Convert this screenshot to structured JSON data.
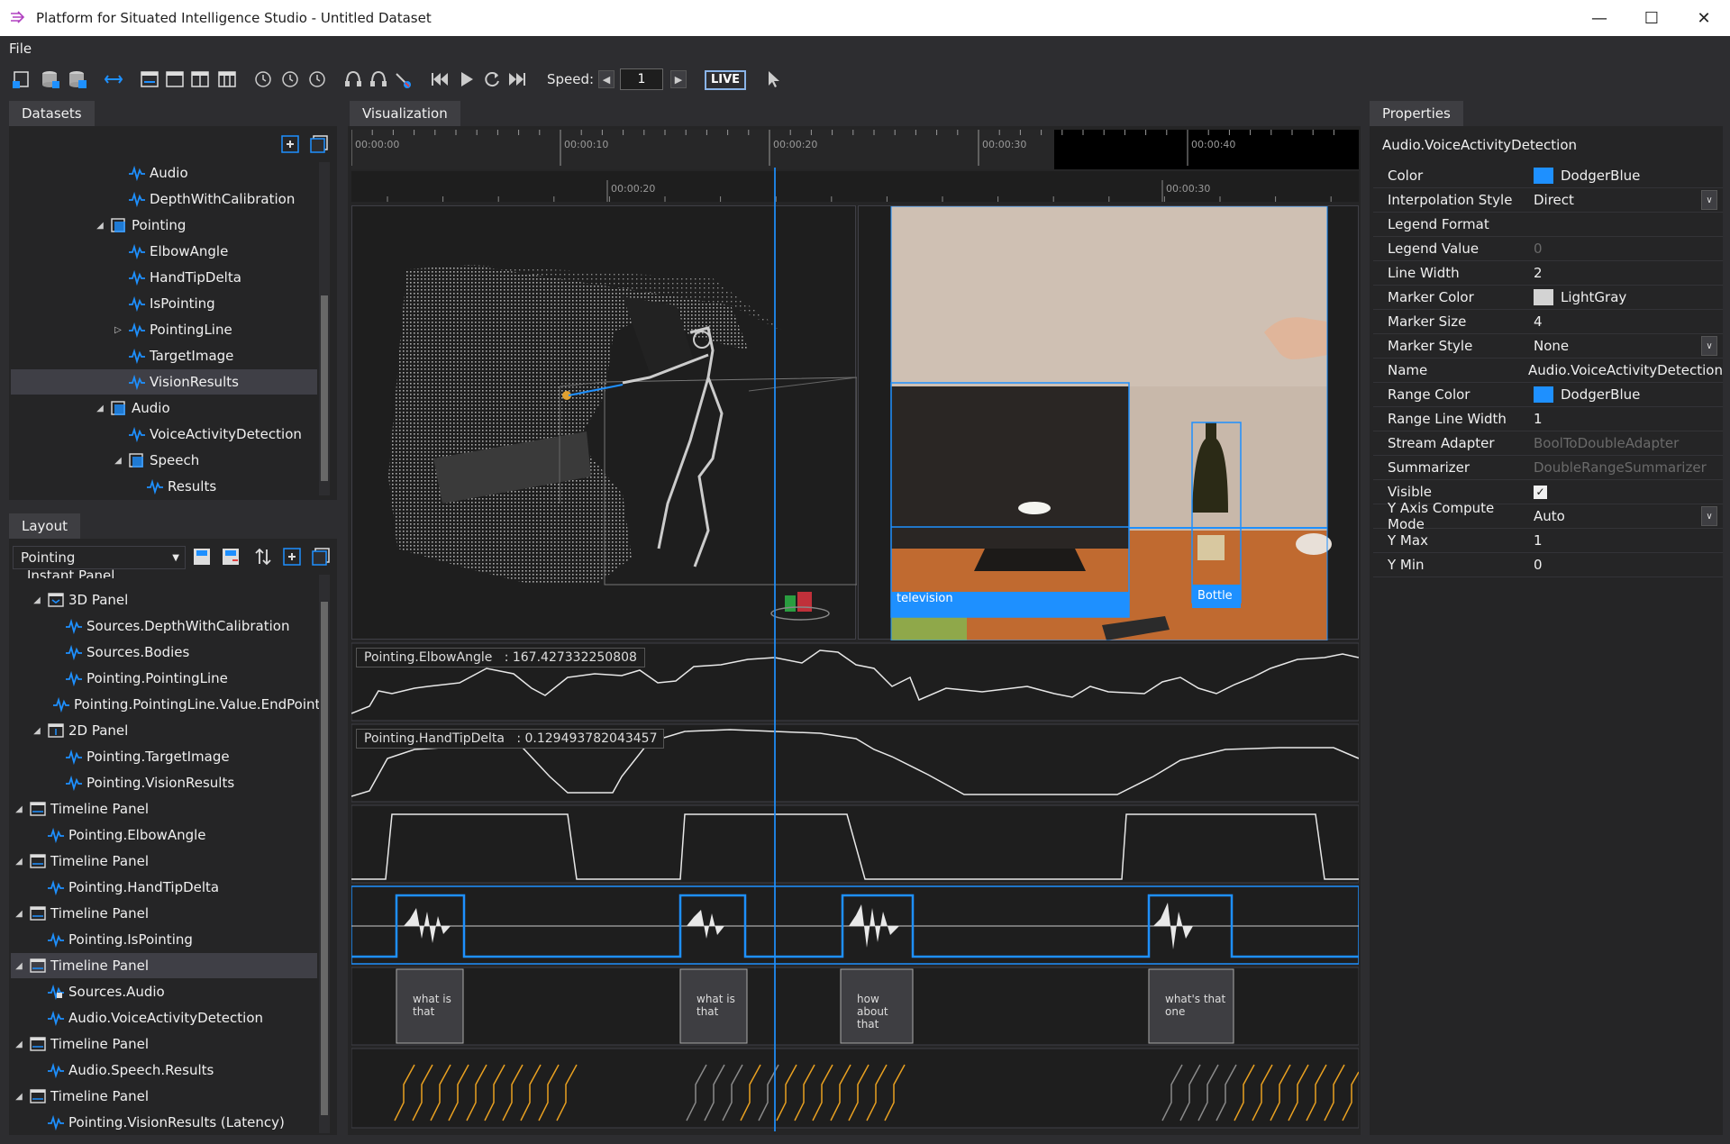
{
  "window": {
    "title": "Platform for Situated Intelligence Studio - Untitled Dataset",
    "accent": "#1e90ff"
  },
  "menu": {
    "file": "File"
  },
  "toolbar": {
    "speed_label": "Speed:",
    "speed_value": "1",
    "live_label": "LIVE"
  },
  "datasets": {
    "tab_label": "Datasets",
    "items": [
      {
        "label": "Audio",
        "level": 3,
        "icon": "stream-icon"
      },
      {
        "label": "DepthWithCalibration",
        "level": 3,
        "icon": "stream-icon"
      },
      {
        "label": "Pointing",
        "level": 2,
        "icon": "partition-icon",
        "expanded": true
      },
      {
        "label": "ElbowAngle",
        "level": 3,
        "icon": "stream-icon"
      },
      {
        "label": "HandTipDelta",
        "level": 3,
        "icon": "stream-icon"
      },
      {
        "label": "IsPointing",
        "level": 3,
        "icon": "stream-icon"
      },
      {
        "label": "PointingLine",
        "level": 3,
        "icon": "stream-icon",
        "collapsed": true
      },
      {
        "label": "TargetImage",
        "level": 3,
        "icon": "stream-icon"
      },
      {
        "label": "VisionResults",
        "level": 3,
        "icon": "stream-icon",
        "selected": true
      },
      {
        "label": "Audio",
        "level": 2,
        "icon": "partition-icon",
        "expanded": true
      },
      {
        "label": "VoiceActivityDetection",
        "level": 3,
        "icon": "stream-icon"
      },
      {
        "label": "Speech",
        "level": 3,
        "icon": "partition-icon",
        "expanded": true
      },
      {
        "label": "Results",
        "level": 4,
        "icon": "stream-icon"
      }
    ]
  },
  "layout": {
    "tab_label": "Layout",
    "selected_layout": "Pointing",
    "partial_top_item": "Instant Panel",
    "items": [
      {
        "label": "3D Panel",
        "level": 2,
        "icon": "panel3d-icon",
        "expanded": true
      },
      {
        "label": "Sources.DepthWithCalibration",
        "level": 3,
        "icon": "stream-icon"
      },
      {
        "label": "Sources.Bodies",
        "level": 3,
        "icon": "stream-icon"
      },
      {
        "label": "Pointing.PointingLine",
        "level": 3,
        "icon": "stream-icon"
      },
      {
        "label": "Pointing.PointingLine.Value.EndPoint",
        "level": 3,
        "icon": "stream-icon"
      },
      {
        "label": "2D Panel",
        "level": 2,
        "icon": "panel2d-icon",
        "expanded": true
      },
      {
        "label": "Pointing.TargetImage",
        "level": 3,
        "icon": "stream-icon"
      },
      {
        "label": "Pointing.VisionResults",
        "level": 3,
        "icon": "stream-icon"
      },
      {
        "label": "Timeline Panel",
        "level": 1,
        "icon": "timeline-panel-icon",
        "expanded": true
      },
      {
        "label": "Pointing.ElbowAngle",
        "level": 2,
        "icon": "stream-icon"
      },
      {
        "label": "Timeline Panel",
        "level": 1,
        "icon": "timeline-panel-icon",
        "expanded": true
      },
      {
        "label": "Pointing.HandTipDelta",
        "level": 2,
        "icon": "stream-icon"
      },
      {
        "label": "Timeline Panel",
        "level": 1,
        "icon": "timeline-panel-icon",
        "expanded": true
      },
      {
        "label": "Pointing.IsPointing",
        "level": 2,
        "icon": "stream-icon"
      },
      {
        "label": "Timeline Panel",
        "level": 1,
        "icon": "timeline-panel-icon",
        "expanded": true,
        "selected": true
      },
      {
        "label": "Sources.Audio",
        "level": 2,
        "icon": "audio-stream-icon"
      },
      {
        "label": "Audio.VoiceActivityDetection",
        "level": 2,
        "icon": "stream-icon"
      },
      {
        "label": "Timeline Panel",
        "level": 1,
        "icon": "timeline-panel-icon",
        "expanded": true
      },
      {
        "label": "Audio.Speech.Results",
        "level": 2,
        "icon": "stream-icon"
      },
      {
        "label": "Timeline Panel",
        "level": 1,
        "icon": "timeline-panel-icon",
        "expanded": true
      },
      {
        "label": "Pointing.VisionResults (Latency)",
        "level": 2,
        "icon": "stream-icon"
      }
    ]
  },
  "visualization": {
    "tab_label": "Visualization",
    "top_ruler_ticks": [
      "00:00:00",
      "00:00:10",
      "00:00:20",
      "00:00:30",
      "00:00:40"
    ],
    "zoom_ruler_ticks": [
      "00:00:20",
      "00:00:30"
    ],
    "elbow_legend": "Pointing.ElbowAngle",
    "elbow_value": ": 167.427332250808",
    "handtip_legend": "Pointing.HandTipDelta",
    "handtip_value": ": 0.129493782043457",
    "detections": [
      {
        "label": "television"
      },
      {
        "label": "Bottle"
      }
    ],
    "speech_results": [
      "what is\nthat",
      "what is\nthat",
      "how about\nthat",
      "what's that\none"
    ]
  },
  "properties": {
    "tab_label": "Properties",
    "header": "Audio.VoiceActivityDetection",
    "rows": [
      {
        "key": "Color",
        "value": "DodgerBlue",
        "swatch": "#1e90ff"
      },
      {
        "key": "Interpolation Style",
        "value": "Direct",
        "dropdown": true
      },
      {
        "key": "Legend Format",
        "value": ""
      },
      {
        "key": "Legend Value",
        "value": "0",
        "dim": true
      },
      {
        "key": "Line Width",
        "value": "2"
      },
      {
        "key": "Marker Color",
        "value": "LightGray",
        "swatch": "#d3d3d3"
      },
      {
        "key": "Marker Size",
        "value": "4"
      },
      {
        "key": "Marker Style",
        "value": "None",
        "dropdown": true
      },
      {
        "key": "Name",
        "value": "Audio.VoiceActivityDetection"
      },
      {
        "key": "Range Color",
        "value": "DodgerBlue",
        "swatch": "#1e90ff"
      },
      {
        "key": "Range Line Width",
        "value": "1"
      },
      {
        "key": "Stream Adapter",
        "value": "BoolToDoubleAdapter",
        "dim": true
      },
      {
        "key": "Summarizer",
        "value": "DoubleRangeSummarizer",
        "dim": true
      },
      {
        "key": "Visible",
        "value": "",
        "checkbox": true
      },
      {
        "key": "Y Axis Compute Mode",
        "value": "Auto",
        "dropdown": true
      },
      {
        "key": "Y Max",
        "value": "1"
      },
      {
        "key": "Y Min",
        "value": "0"
      }
    ]
  }
}
